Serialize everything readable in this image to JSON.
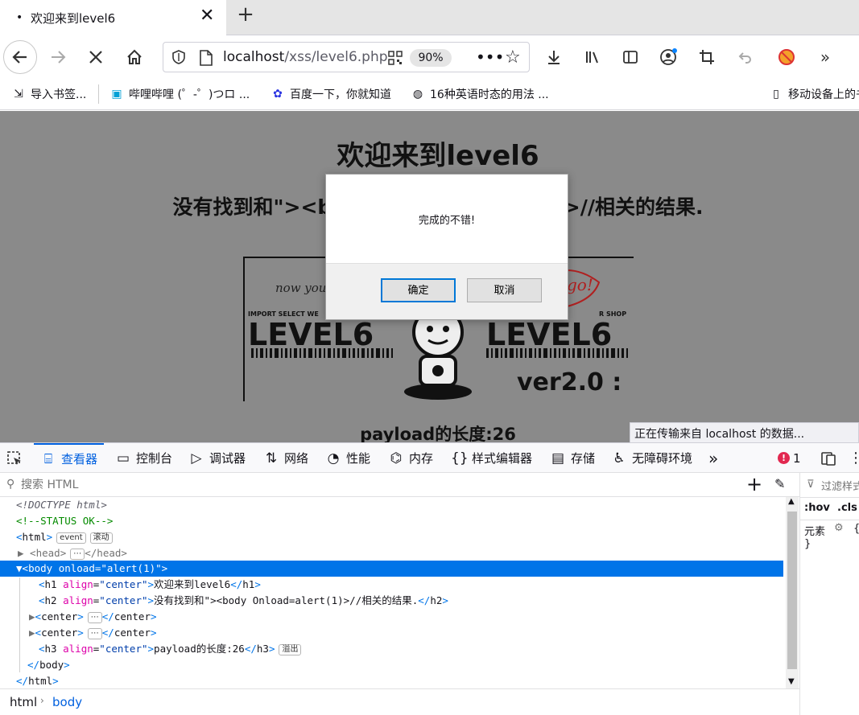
{
  "browser": {
    "tab_title": "欢迎来到level6",
    "tab_dot": "•",
    "url_host": "localhost",
    "url_path": "/xss/level6.php",
    "zoom": "90%"
  },
  "bookmarks": [
    {
      "label": "导入书签...",
      "icon": "import-icon"
    },
    {
      "label": "哔哩哔哩 (゜-゜)つロ ...",
      "icon": "bilibili-icon"
    },
    {
      "label": "百度一下，你就知道",
      "icon": "baidu-icon"
    },
    {
      "label": "16种英语时态的用法 ...",
      "icon": "globe-icon"
    },
    {
      "label": "移动设备上的书",
      "icon": "mobile-icon"
    }
  ],
  "page": {
    "h1": "欢迎来到level6",
    "h2": "没有找到和\"><body Onload=alert(1)>//相关的结果.",
    "h3": "payload的长度:26",
    "image_text": {
      "top_line": "IMPORT SELECT WE",
      "top_right": "R SHOP",
      "left_logo": "LEVEL6",
      "right_logo": "LEVEL6",
      "version": "ver2.0 :",
      "handwriting_left": "now you'r",
      "handwriting_right": "go!"
    },
    "status_tooltip": "正在传输来自 localhost 的数据..."
  },
  "dialog": {
    "message": "完成的不错!",
    "ok_label": "确定",
    "cancel_label": "取消"
  },
  "devtools": {
    "tabs": [
      {
        "label": "查看器",
        "icon": "inspector-icon"
      },
      {
        "label": "控制台",
        "icon": "console-icon"
      },
      {
        "label": "调试器",
        "icon": "debugger-icon"
      },
      {
        "label": "网络",
        "icon": "network-icon"
      },
      {
        "label": "性能",
        "icon": "performance-icon"
      },
      {
        "label": "内存",
        "icon": "memory-icon"
      },
      {
        "label": "样式编辑器",
        "icon": "style-editor-icon"
      },
      {
        "label": "存储",
        "icon": "storage-icon"
      },
      {
        "label": "无障碍环境",
        "icon": "accessibility-icon"
      }
    ],
    "error_count": "1",
    "search_placeholder": "搜索 HTML",
    "side_filter": "过滤样式",
    "side_hov": ":hov",
    "side_cls": ".cls",
    "side_element": "元素",
    "side_brace_open": "{",
    "side_brace_close": "}",
    "markup": {
      "doctype": "<!DOCTYPE html>",
      "comment": "<!--STATUS OK-->",
      "html_tag": "html",
      "badge_event": "event",
      "badge_scroll": "滚动",
      "head_tag": "head",
      "body_tag": "body",
      "body_attr": "onload",
      "body_attr_value": "\"alert(1)\"",
      "h1_tag": "h1",
      "align_attr": "align",
      "center_value": "\"center\"",
      "h1_text": "欢迎来到level6",
      "h2_tag": "h2",
      "h2_text": "没有找到和\"><body Onload=alert(1)>//相关的结果.",
      "center_tag": "center",
      "h3_tag": "h3",
      "h3_text": "payload的长度:26",
      "badge_overflow": "溢出",
      "ellipsis": "⋯"
    },
    "breadcrumbs": [
      "html",
      "body"
    ]
  }
}
